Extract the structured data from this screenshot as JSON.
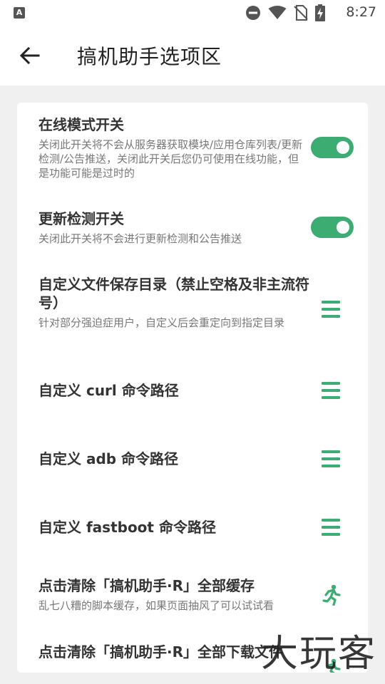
{
  "status_bar": {
    "time": "8:27",
    "notification_icon": "A",
    "icons": [
      "do-not-disturb-icon",
      "wifi-icon",
      "no-sim-icon",
      "battery-charging-icon"
    ]
  },
  "app_bar": {
    "back_icon": "arrow-left-icon",
    "title": "搞机助手选项区"
  },
  "settings": {
    "online_mode": {
      "title": "在线模式开关",
      "subtitle": "关闭此开关将不会从服务器获取模块/应用仓库列表/更新检测/公告推送，关闭此开关后您仍可使用在线功能，但是功能可能是过时的",
      "enabled": true
    },
    "update_check": {
      "title": "更新检测开关",
      "subtitle": "关闭此开关将不会进行更新检测和公告推送",
      "enabled": true
    },
    "custom_dir": {
      "title": "自定义文件保存目录（禁止空格及非主流符号）",
      "subtitle": "针对部分强迫症用户，自定义后会重定向到指定目录"
    },
    "curl_path": {
      "title": "自定义 curl 命令路径"
    },
    "adb_path": {
      "title": "自定义 adb 命令路径"
    },
    "fastboot_path": {
      "title": "自定义 fastboot 命令路径"
    },
    "clear_cache": {
      "title": "点击清除「搞机助手·R」全部缓存",
      "subtitle": "乱七八糟的脚本缓存，如果页面抽风了可以试试看"
    },
    "clear_downloads": {
      "title": "点击清除「搞机助手·R」全部下载文件"
    }
  },
  "watermark": "大玩客",
  "colors": {
    "accent": "#3cac72",
    "background": "#f0f0f0",
    "card": "#ffffff"
  }
}
